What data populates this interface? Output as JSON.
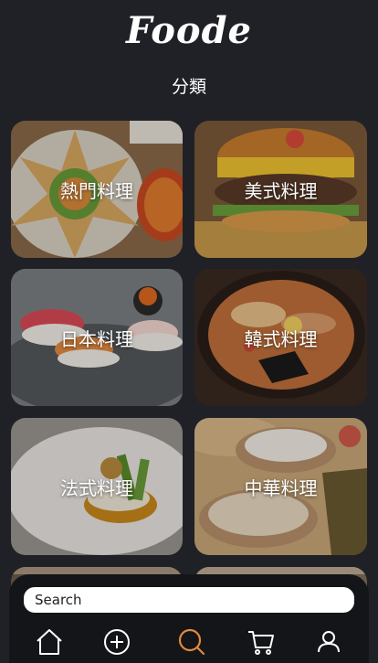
{
  "app": {
    "logo": "Foode"
  },
  "page": {
    "section_title": "分類"
  },
  "categories": [
    {
      "label": "熱門料理"
    },
    {
      "label": "美式料理"
    },
    {
      "label": "日本料理"
    },
    {
      "label": "韓式料理"
    },
    {
      "label": "法式料理"
    },
    {
      "label": "中華料理"
    }
  ],
  "search": {
    "placeholder": "Search"
  },
  "nav": {
    "items": [
      {
        "icon": "home-icon"
      },
      {
        "icon": "add-icon"
      },
      {
        "icon": "search-icon",
        "active": true
      },
      {
        "icon": "cart-icon"
      },
      {
        "icon": "user-icon"
      }
    ],
    "active_color": "#e08a3c",
    "inactive_color": "#ffffff"
  }
}
